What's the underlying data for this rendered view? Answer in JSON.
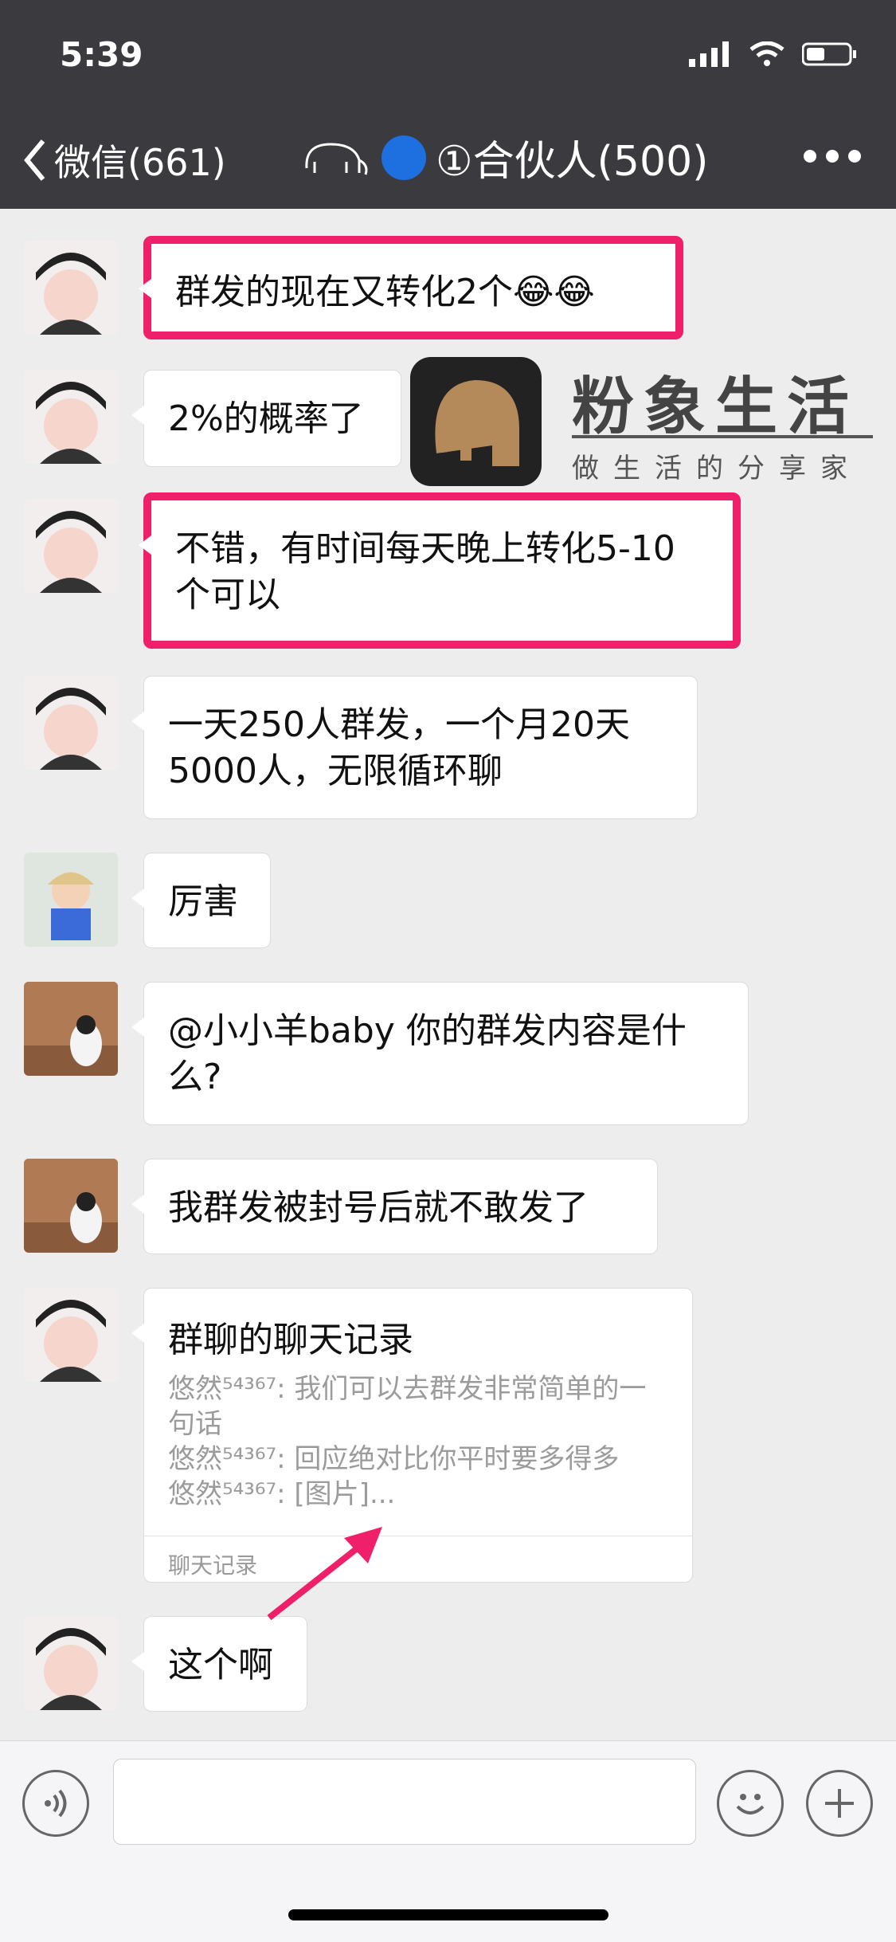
{
  "status": {
    "time": "5:39"
  },
  "nav": {
    "back_label": "微信(661)",
    "title": "①合伙人(500)"
  },
  "watermark": {
    "title": "粉象生活",
    "subtitle": "做生活的分享家"
  },
  "messages": [
    {
      "text": "群发的现在又转化2个😂😂"
    },
    {
      "text": "2%的概率了"
    },
    {
      "text": "不错，有时间每天晚上转化5-10个可以"
    },
    {
      "text": "一天250人群发，一个月20天5000人，无限循环聊"
    },
    {
      "text": "厉害"
    },
    {
      "text": "@小小羊baby 你的群发内容是什么?"
    },
    {
      "text": "我群发被封号后就不敢发了"
    },
    {
      "text": "这个啊"
    }
  ],
  "chat_record_card": {
    "title": "群聊的聊天记录",
    "lines": [
      "悠然⁵⁴³⁶⁷: 我们可以去群发非常简单的一句话",
      "悠然⁵⁴³⁶⁷: 回应绝对比你平时要多得多",
      "悠然⁵⁴³⁶⁷: [图片]..."
    ],
    "footer": "聊天记录"
  },
  "colors": {
    "highlight": "#ef1f69",
    "header_bg": "#3b3b3f",
    "chat_bg": "#ededed"
  }
}
